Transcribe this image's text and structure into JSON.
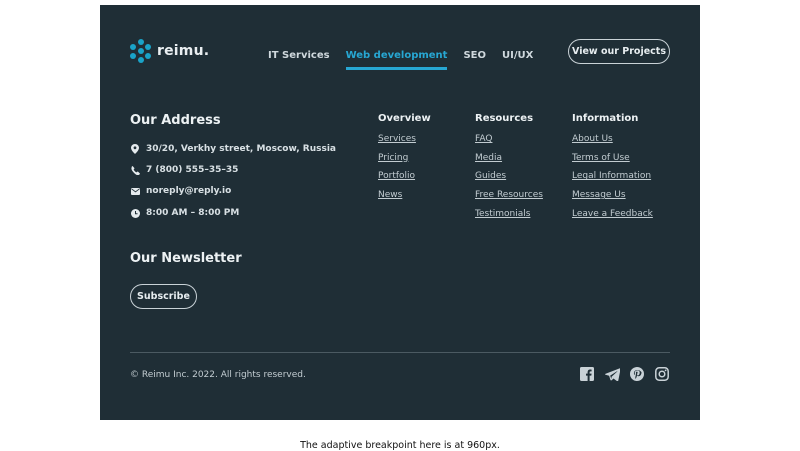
{
  "brand": {
    "name": "reimu.",
    "accent": "#1aa3c8",
    "bg": "#1f2e36"
  },
  "nav": {
    "items": [
      {
        "label": "IT Services",
        "active": false
      },
      {
        "label": "Web development",
        "active": true
      },
      {
        "label": "SEO",
        "active": false
      },
      {
        "label": "UI/UX",
        "active": false
      }
    ]
  },
  "cta": {
    "label": "View our Projects"
  },
  "address": {
    "title": "Our Address",
    "rows": [
      {
        "icon": "location-pin-icon",
        "text": "30/20, Verkhy street, Moscow, Russia"
      },
      {
        "icon": "phone-icon",
        "text": "7 (800) 555–35–35"
      },
      {
        "icon": "mail-icon",
        "text": "noreply@reply.io"
      },
      {
        "icon": "clock-icon",
        "text": "8:00 AM – 8:00 PM"
      }
    ]
  },
  "columns": [
    {
      "title": "Overview",
      "links": [
        "Services",
        "Pricing",
        "Portfolio",
        "News"
      ]
    },
    {
      "title": "Resources",
      "links": [
        "FAQ",
        "Media",
        "Guides",
        "Free Resources",
        "Testimonials"
      ]
    },
    {
      "title": "Information",
      "links": [
        "About Us",
        "Terms of Use",
        "Legal Information",
        "Message Us",
        "Leave a Feedback"
      ]
    }
  ],
  "newsletter": {
    "title": "Our Newsletter",
    "button": "Subscribe"
  },
  "copyright": "© Reimu Inc. 2022. All rights reserved.",
  "social": [
    "facebook-icon",
    "telegram-icon",
    "pinterest-icon",
    "instagram-icon"
  ],
  "note": "The adaptive breakpoint here is at 960px."
}
